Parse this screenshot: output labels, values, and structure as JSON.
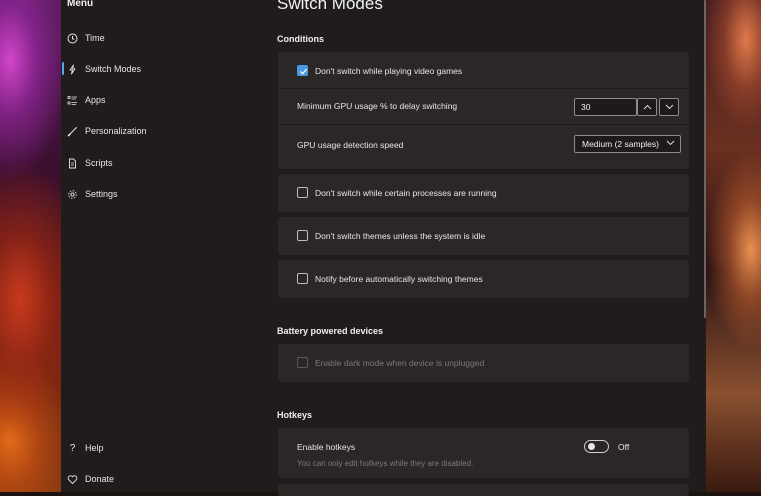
{
  "menu": {
    "title": "Menu"
  },
  "sidebar": {
    "items": [
      {
        "label": "Time",
        "icon": "clock-icon"
      },
      {
        "label": "Switch Modes",
        "icon": "lightning-icon",
        "active": true
      },
      {
        "label": "Apps",
        "icon": "list-icon"
      },
      {
        "label": "Personalization",
        "icon": "brush-icon"
      },
      {
        "label": "Scripts",
        "icon": "document-icon"
      },
      {
        "label": "Settings",
        "icon": "gear-icon"
      }
    ],
    "footer": [
      {
        "label": "Help",
        "icon": "question-icon"
      },
      {
        "label": "Donate",
        "icon": "heart-icon"
      }
    ]
  },
  "page": {
    "title": "Switch Modes"
  },
  "conditions": {
    "title": "Conditions",
    "games": {
      "label": "Don't switch while playing video games",
      "checked": true
    },
    "gpu_usage": {
      "label": "Minimum GPU usage % to delay switching",
      "value": "30"
    },
    "gpu_speed": {
      "label": "GPU usage detection speed",
      "value": "Medium (2 samples)"
    },
    "processes": {
      "label": "Don't switch while certain processes are running",
      "checked": false
    },
    "idle": {
      "label": "Don't switch themes unless the system is idle",
      "checked": false
    },
    "notify": {
      "label": "Notify before automatically switching themes",
      "checked": false
    }
  },
  "battery": {
    "title": "Battery powered devices",
    "unplugged": {
      "label": "Enable dark mode when device is unplugged",
      "checked": false,
      "disabled": true
    }
  },
  "hotkeys": {
    "title": "Hotkeys",
    "enable": {
      "label": "Enable hotkeys",
      "note": "You can only edit hotkeys while they are disabled.",
      "state": "Off",
      "on": false
    }
  },
  "colors": {
    "accent": "#4a9ae0",
    "card": "#2b2727",
    "window": "#201c1c"
  }
}
